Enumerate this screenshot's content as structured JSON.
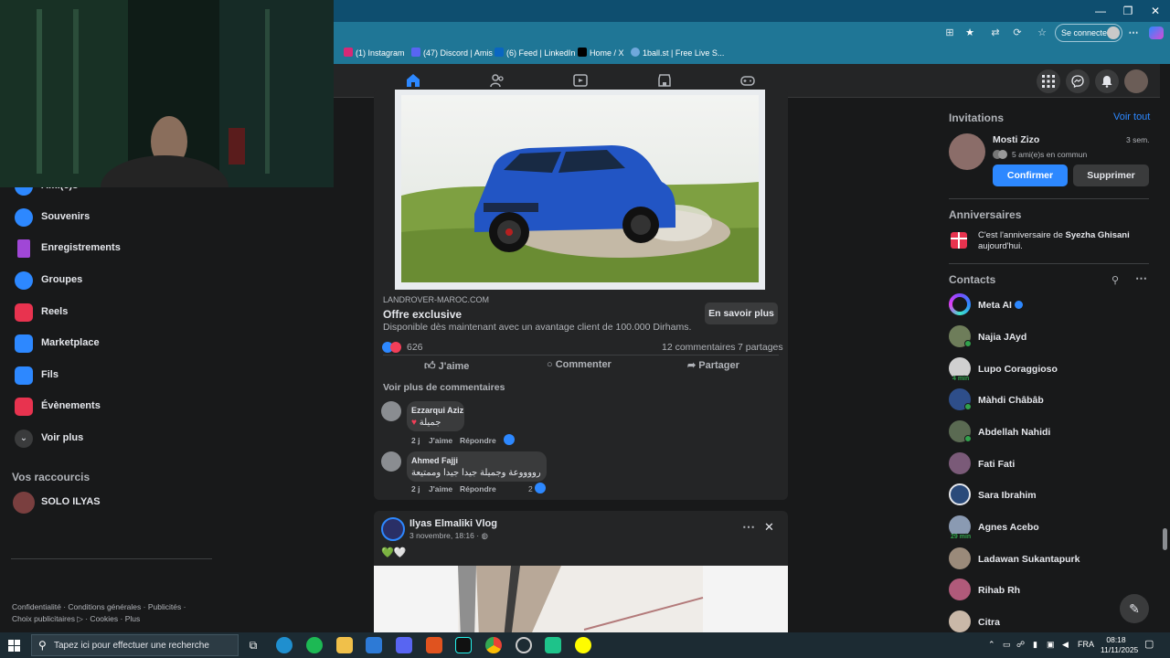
{
  "browser": {
    "sign_in": "Se connecter",
    "bookmarks": [
      {
        "label": "(1) Instagram",
        "icon": "instagram-icon",
        "color": "#d62976"
      },
      {
        "label": "(47) Discord | Amis",
        "icon": "discord-icon",
        "color": "#5865f2"
      },
      {
        "label": "(6) Feed | LinkedIn",
        "icon": "linkedin-icon",
        "color": "#0a66c2"
      },
      {
        "label": "Home / X",
        "icon": "x-icon",
        "color": "#000000"
      },
      {
        "label": "1ball.st | Free Live S...",
        "icon": "globe-icon",
        "color": "#6fa8dc"
      }
    ]
  },
  "fb_nav": {
    "tabs": [
      "home-icon",
      "friends-icon",
      "watch-icon",
      "marketplace-icon",
      "gaming-icon"
    ],
    "active_tab": "home-icon"
  },
  "left_sidebar": {
    "items": [
      {
        "label": "Ami(e)s",
        "color": "#2d88ff"
      },
      {
        "label": "Souvenirs",
        "color": "#2d88ff"
      },
      {
        "label": "Enregistrements",
        "color": "#a047d6"
      },
      {
        "label": "Groupes",
        "color": "#2d88ff"
      },
      {
        "label": "Reels",
        "color": "#e8334f"
      },
      {
        "label": "Marketplace",
        "color": "#2d88ff"
      },
      {
        "label": "Fils",
        "color": "#2d88ff"
      },
      {
        "label": "Évènements",
        "color": "#e8334f"
      },
      {
        "label": "Voir plus",
        "color": "#3a3b3c"
      }
    ],
    "shortcuts_title": "Vos raccourcis",
    "shortcuts": [
      {
        "label": "SOLO ILYAS"
      }
    ],
    "footer_line1": "Confidentialité · Conditions générales · Publicités ·",
    "footer_line2": "Choix publicitaires ▷ · Cookies · Plus"
  },
  "ad_post": {
    "domain": "LANDROVER-MAROC.COM",
    "title": "Offre exclusive",
    "description": "Disponible dès maintenant avec un avantage client de 100.000 Dirhams.",
    "cta": "En savoir plus",
    "reactions_count": "626",
    "comments_count": "12 commentaires",
    "shares_count": "7 partages",
    "like_label": "J'aime",
    "comment_label": "Commenter",
    "share_label": "Partager",
    "more_comments": "Voir plus de commentaires",
    "comments": [
      {
        "author": "Ezzarqui Aziz",
        "text": "جميلة",
        "time": "2 j",
        "like": "J'aime",
        "reply": "Répondre",
        "likes": ""
      },
      {
        "author": "Ahmed Fajji",
        "text": "رووووعة وجميلة جيدا جيدا وممتيعة",
        "time": "2 j",
        "like": "J'aime",
        "reply": "Répondre",
        "likes": "2"
      }
    ]
  },
  "post2": {
    "author": "Ilyas Elmaliki Vlog",
    "date": "3 novembre, 18:16 ·",
    "content": "💚🤍"
  },
  "right_sidebar": {
    "invitations_title": "Invitations",
    "see_all": "Voir tout",
    "invite": {
      "name": "Mosti Zizo",
      "age": "3 sem.",
      "mutual": "5 ami(e)s en commun",
      "confirm": "Confirmer",
      "delete": "Supprimer"
    },
    "birthdays_title": "Anniversaires",
    "birthday_prefix": "C'est l'anniversaire de ",
    "birthday_name": "Syezha Ghisani",
    "birthday_suffix": "aujourd'hui.",
    "contacts_title": "Contacts",
    "contacts": [
      {
        "name": "Meta AI",
        "status": "verified"
      },
      {
        "name": "Najia JAyd",
        "status": "online"
      },
      {
        "name": "Lupo Coraggioso",
        "status": "4 min"
      },
      {
        "name": "Màhdi Châbâb",
        "status": "online"
      },
      {
        "name": "Abdellah Nahidi",
        "status": "online"
      },
      {
        "name": "Fati Fati",
        "status": ""
      },
      {
        "name": "Sara Ibrahim",
        "status": ""
      },
      {
        "name": "Agnes Acebo",
        "status": "29 min"
      },
      {
        "name": "Ladawan Sukantapurk",
        "status": ""
      },
      {
        "name": "Rihab Rh",
        "status": ""
      },
      {
        "name": "Citra",
        "status": ""
      }
    ]
  },
  "taskbar": {
    "search_placeholder": "Tapez ici pour effectuer une recherche",
    "lang": "FRA",
    "time": "08:18",
    "date": "11/11/2025"
  }
}
